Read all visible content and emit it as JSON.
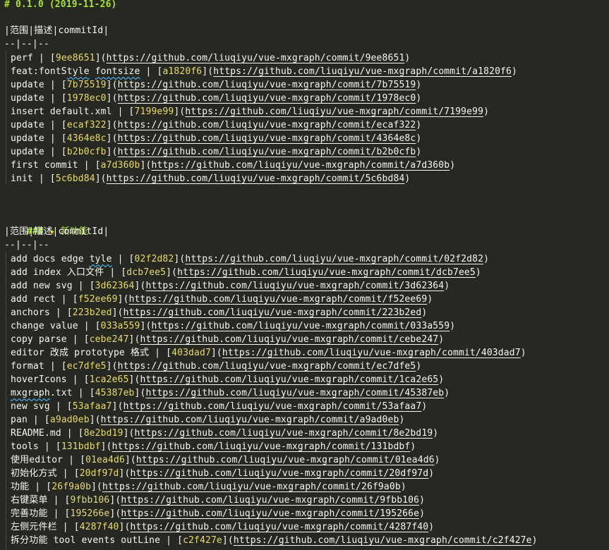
{
  "sections": [
    {
      "heading": "# 0.1.0 (2019-11-26)",
      "table_header": "|范围|描述|commitId|",
      "separator": "--|--|--",
      "rows": [
        {
          "desc": "perf",
          "hash": "9ee8651",
          "url": "https://github.com/liuqiyu/vue-mxgraph/commit/9ee8651"
        },
        {
          "desc": "feat:fontStyle fontsize",
          "hash": "a1820f6",
          "url": "https://github.com/liuqiyu/vue-mxgraph/commit/a1820f6"
        },
        {
          "desc": "update",
          "hash": "7b75519",
          "url": "https://github.com/liuqiyu/vue-mxgraph/commit/7b75519"
        },
        {
          "desc": "update",
          "hash": "1978ec0",
          "url": "https://github.com/liuqiyu/vue-mxgraph/commit/1978ec0"
        },
        {
          "desc": "insert default.xml",
          "hash": "7199e99",
          "url": "https://github.com/liuqiyu/vue-mxgraph/commit/7199e99"
        },
        {
          "desc": "update",
          "hash": "ecaf322",
          "url": "https://github.com/liuqiyu/vue-mxgraph/commit/ecaf322"
        },
        {
          "desc": "update",
          "hash": "4364e8c",
          "url": "https://github.com/liuqiyu/vue-mxgraph/commit/4364e8c"
        },
        {
          "desc": "update",
          "hash": "b2b0cfb",
          "url": "https://github.com/liuqiyu/vue-mxgraph/commit/b2b0cfb"
        },
        {
          "desc": "first commit",
          "hash": "a7d360b",
          "url": "https://github.com/liuqiyu/vue-mxgraph/commit/a7d360b"
        },
        {
          "desc": "init",
          "hash": "5c6bd84",
          "url": "https://github.com/liuqiyu/vue-mxgraph/commit/5c6bd84"
        }
      ]
    },
    {
      "heading_prefix": "###",
      "heading_icon": "star-icon",
      "heading_text": "新功能",
      "table_header": "|范围|描述|commitId|",
      "separator": "--|--|--",
      "rows": [
        {
          "desc": "add docs edge tyle",
          "hash": "02f2d82",
          "url": "https://github.com/liuqiyu/vue-mxgraph/commit/02f2d82"
        },
        {
          "desc": "add index 入口文件",
          "hash": "dcb7ee5",
          "url": "https://github.com/liuqiyu/vue-mxgraph/commit/dcb7ee5"
        },
        {
          "desc": "add new svg",
          "hash": "3d62364",
          "url": "https://github.com/liuqiyu/vue-mxgraph/commit/3d62364"
        },
        {
          "desc": "add rect",
          "hash": "f52ee69",
          "url": "https://github.com/liuqiyu/vue-mxgraph/commit/f52ee69"
        },
        {
          "desc": "anchors",
          "hash": "223b2ed",
          "url": "https://github.com/liuqiyu/vue-mxgraph/commit/223b2ed"
        },
        {
          "desc": "change value",
          "hash": "033a559",
          "url": "https://github.com/liuqiyu/vue-mxgraph/commit/033a559"
        },
        {
          "desc": "copy parse",
          "hash": "cebe247",
          "url": "https://github.com/liuqiyu/vue-mxgraph/commit/cebe247"
        },
        {
          "desc": "editor 改成 prototype 格式",
          "hash": "403dad7",
          "url": "https://github.com/liuqiyu/vue-mxgraph/commit/403dad7"
        },
        {
          "desc": "format",
          "hash": "ec7dfe5",
          "url": "https://github.com/liuqiyu/vue-mxgraph/commit/ec7dfe5"
        },
        {
          "desc": "hoverIcons",
          "hash": "1ca2e65",
          "url": "https://github.com/liuqiyu/vue-mxgraph/commit/1ca2e65"
        },
        {
          "desc": "mxgraph.txt",
          "hash": "45387eb",
          "url": "https://github.com/liuqiyu/vue-mxgraph/commit/45387eb"
        },
        {
          "desc": "new svg",
          "hash": "53afaa7",
          "url": "https://github.com/liuqiyu/vue-mxgraph/commit/53afaa7"
        },
        {
          "desc": "pan",
          "hash": "a9ad0eb",
          "url": "https://github.com/liuqiyu/vue-mxgraph/commit/a9ad0eb"
        },
        {
          "desc": "README.md",
          "hash": "8e2bd19",
          "url": "https://github.com/liuqiyu/vue-mxgraph/commit/8e2bd19"
        },
        {
          "desc": "tools",
          "hash": "131bdbf",
          "url": "https://github.com/liuqiyu/vue-mxgraph/commit/131bdbf"
        },
        {
          "desc": "使用editor",
          "hash": "01ea4d6",
          "url": "https://github.com/liuqiyu/vue-mxgraph/commit/01ea4d6"
        },
        {
          "desc": "初始化方式",
          "hash": "20df97d",
          "url": "https://github.com/liuqiyu/vue-mxgraph/commit/20df97d"
        },
        {
          "desc": "功能",
          "hash": "26f9a0b",
          "url": "https://github.com/liuqiyu/vue-mxgraph/commit/26f9a0b"
        },
        {
          "desc": "右键菜单",
          "hash": "9fbb106",
          "url": "https://github.com/liuqiyu/vue-mxgraph/commit/9fbb106"
        },
        {
          "desc": "完善功能",
          "hash": "195266e",
          "url": "https://github.com/liuqiyu/vue-mxgraph/commit/195266e"
        },
        {
          "desc": "左侧元件栏",
          "hash": "4287f40",
          "url": "https://github.com/liuqiyu/vue-mxgraph/commit/4287f40"
        },
        {
          "desc": "拆分功能 tool events outLine",
          "hash": "c2f427e",
          "url": "https://github.com/liuqiyu/vue-mxgraph/commit/c2f427e"
        }
      ]
    }
  ],
  "colors": {
    "background": "#272822",
    "heading": "#a6e22e",
    "hash": "#e6db74",
    "text": "#f8f8f2",
    "spellcheck": "#4aa3df"
  }
}
